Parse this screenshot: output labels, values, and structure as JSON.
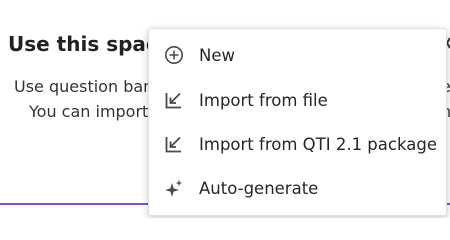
{
  "background": {
    "title": "Use this space",
    "line1": "Use question ban",
    "line2": "You can import",
    "right_edge_line1": "e",
    "right_edge_line2": "n"
  },
  "menu": {
    "items": [
      {
        "label": "New",
        "icon": "plus-circle-icon"
      },
      {
        "label": "Import from file",
        "icon": "import-icon"
      },
      {
        "label": "Import from QTI 2.1 package",
        "icon": "import-icon"
      },
      {
        "label": "Auto-generate",
        "icon": "sparkle-icon"
      }
    ]
  },
  "colors": {
    "accent_line": "#8a4fc7",
    "icon_color": "#4a4a4a",
    "text_color": "#262626"
  }
}
